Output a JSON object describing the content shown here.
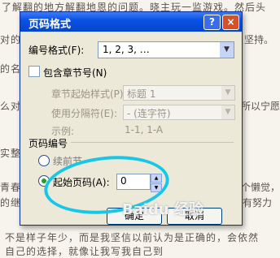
{
  "background": {
    "lines": [
      "了解翻的地方解翻地恩的问题。晓主玩一监游戏。然后头",
      "对的",
      "的名讲",
      "么对",
      "实整理",
      "青春",
      "的继续",
      "不是样子年少，而是我坚信以前认为是正确的，会依然",
      "自己的选择，就像让我写我自己到"
    ],
    "right_fragments": [
      "坚持。",
      "所以宁愿",
      "个懒觉，",
      "有努力"
    ]
  },
  "dialog": {
    "title": "页码格式",
    "help_label": "?",
    "close_label": "×",
    "number_format": {
      "label": "编号格式(F):",
      "value": "1, 2, 3, …"
    },
    "include_chapter": {
      "label": "包含章节号(N)",
      "checked": false
    },
    "chapter_style": {
      "label": "章节起始样式(P)",
      "value": "标题 1"
    },
    "separator": {
      "label": "使用分隔符(E):",
      "value": "-   (连字符)"
    },
    "example": {
      "label": "示例:",
      "value": "1-1, 1-A"
    },
    "page_numbering": {
      "group_label": "页码编号",
      "continue_label": "续前节",
      "start_at_label": "起始页码(A):",
      "start_at_value": "0",
      "selected": "start_at"
    },
    "ok_label": "确定",
    "cancel_label": "取消"
  },
  "watermark": "Baidu 经验"
}
